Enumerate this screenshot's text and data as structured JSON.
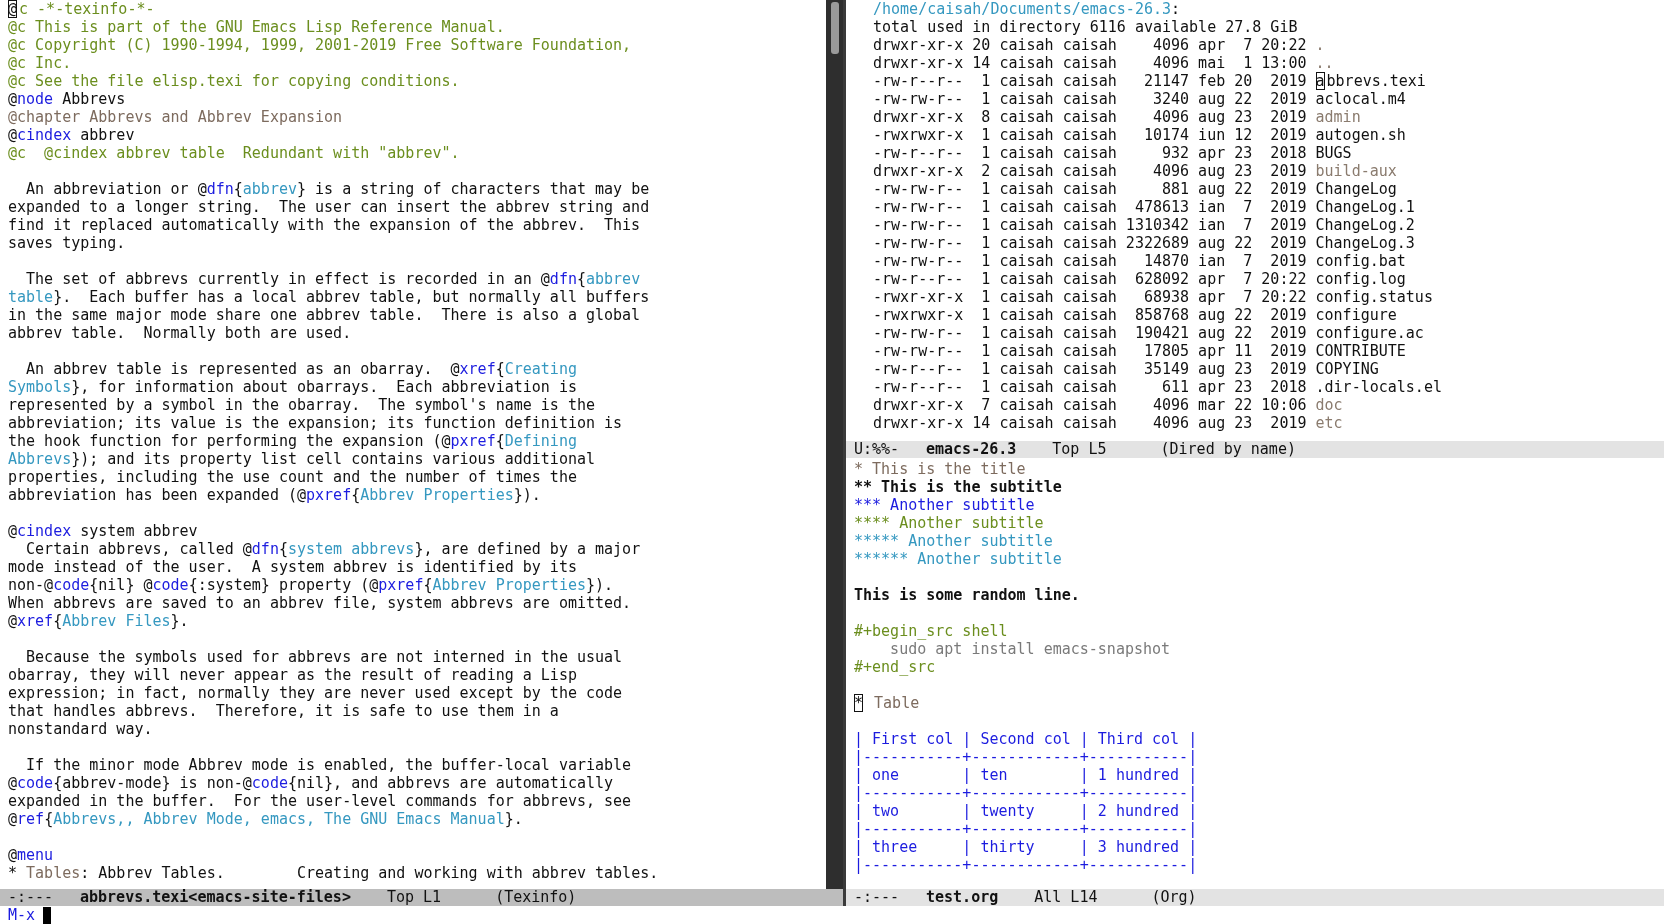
{
  "texinfo_pane": {
    "blocks": [
      [
        [
          {
            "text": "@",
            "kind": "cursor"
          },
          {
            "text": "c -*-texinfo-*-",
            "kind": "comment"
          }
        ],
        [
          {
            "text": "@c This is part of the GNU Emacs Lisp Reference Manual.",
            "kind": "comment"
          }
        ],
        [
          {
            "text": "@c Copyright (C) 1990-1994, 1999, 2001-2019 Free Software Foundation,",
            "kind": "comment"
          }
        ],
        [
          {
            "text": "@c Inc.",
            "kind": "comment"
          }
        ],
        [
          {
            "text": "@c See the file elisp.texi for copying conditions.",
            "kind": "comment"
          }
        ],
        [
          {
            "text": "@",
            "kind": "plain"
          },
          {
            "text": "node",
            "kind": "keyword"
          },
          {
            "text": " Abbrevs",
            "kind": "plain"
          }
        ],
        [
          {
            "text": "@chapter Abbrevs and Abbrev Expansion",
            "kind": "chapter"
          }
        ],
        [
          {
            "text": "@",
            "kind": "plain"
          },
          {
            "text": "cindex",
            "kind": "keyword"
          },
          {
            "text": " abbrev",
            "kind": "plain"
          }
        ],
        [
          {
            "text": "@c  @cindex abbrev table  Redundant with \"abbrev\".",
            "kind": "comment"
          }
        ]
      ],
      [
        [
          {
            "text": "  An abbreviation or @",
            "kind": "plain"
          },
          {
            "text": "dfn",
            "kind": "keyword"
          },
          {
            "text": "{",
            "kind": "plain"
          },
          {
            "text": "abbrev",
            "kind": "link"
          },
          {
            "text": "} is a string of characters that may be",
            "kind": "plain"
          }
        ],
        [
          {
            "text": "expanded to a longer string.  The user can insert the abbrev string and",
            "kind": "plain"
          }
        ],
        [
          {
            "text": "find it replaced automatically with the expansion of the abbrev.  This",
            "kind": "plain"
          }
        ],
        [
          {
            "text": "saves typing.",
            "kind": "plain"
          }
        ]
      ],
      [
        [
          {
            "text": "  The set of abbrevs currently in effect is recorded in an @",
            "kind": "plain"
          },
          {
            "text": "dfn",
            "kind": "keyword"
          },
          {
            "text": "{",
            "kind": "plain"
          },
          {
            "text": "abbrev",
            "kind": "link"
          }
        ],
        [
          {
            "text": "table",
            "kind": "link"
          },
          {
            "text": "}.  Each buffer has a local abbrev table, but normally all buffers",
            "kind": "plain"
          }
        ],
        [
          {
            "text": "in the same major mode share one abbrev table.  There is also a global",
            "kind": "plain"
          }
        ],
        [
          {
            "text": "abbrev table.  Normally both are used.",
            "kind": "plain"
          }
        ]
      ],
      [
        [
          {
            "text": "  An abbrev table is represented as an obarray.  @",
            "kind": "plain"
          },
          {
            "text": "xref",
            "kind": "keyword"
          },
          {
            "text": "{",
            "kind": "plain"
          },
          {
            "text": "Creating",
            "kind": "link"
          }
        ],
        [
          {
            "text": "Symbols",
            "kind": "link"
          },
          {
            "text": "}, for information about obarrays.  Each abbreviation is",
            "kind": "plain"
          }
        ],
        [
          {
            "text": "represented by a symbol in the obarray.  The symbol's name is the",
            "kind": "plain"
          }
        ],
        [
          {
            "text": "abbreviation; its value is the expansion; its function definition is",
            "kind": "plain"
          }
        ],
        [
          {
            "text": "the hook function for performing the expansion (@",
            "kind": "plain"
          },
          {
            "text": "pxref",
            "kind": "keyword"
          },
          {
            "text": "{",
            "kind": "plain"
          },
          {
            "text": "Defining",
            "kind": "link"
          }
        ],
        [
          {
            "text": "Abbrevs",
            "kind": "link"
          },
          {
            "text": "}); and its property list cell contains various additional",
            "kind": "plain"
          }
        ],
        [
          {
            "text": "properties, including the use count and the number of times the",
            "kind": "plain"
          }
        ],
        [
          {
            "text": "abbreviation has been expanded (@",
            "kind": "plain"
          },
          {
            "text": "pxref",
            "kind": "keyword"
          },
          {
            "text": "{",
            "kind": "plain"
          },
          {
            "text": "Abbrev Properties",
            "kind": "link"
          },
          {
            "text": "}).",
            "kind": "plain"
          }
        ]
      ],
      [
        [
          {
            "text": "@",
            "kind": "plain"
          },
          {
            "text": "cindex",
            "kind": "keyword"
          },
          {
            "text": " system abbrev",
            "kind": "plain"
          }
        ],
        [
          {
            "text": "  Certain abbrevs, called @",
            "kind": "plain"
          },
          {
            "text": "dfn",
            "kind": "keyword"
          },
          {
            "text": "{",
            "kind": "plain"
          },
          {
            "text": "system abbrevs",
            "kind": "link"
          },
          {
            "text": "}, are defined by a major",
            "kind": "plain"
          }
        ],
        [
          {
            "text": "mode instead of the user.  A system abbrev is identified by its",
            "kind": "plain"
          }
        ],
        [
          {
            "text": "non-@",
            "kind": "plain"
          },
          {
            "text": "code",
            "kind": "keyword"
          },
          {
            "text": "{nil} @",
            "kind": "plain"
          },
          {
            "text": "code",
            "kind": "keyword"
          },
          {
            "text": "{:system} property (@",
            "kind": "plain"
          },
          {
            "text": "pxref",
            "kind": "keyword"
          },
          {
            "text": "{",
            "kind": "plain"
          },
          {
            "text": "Abbrev Properties",
            "kind": "link"
          },
          {
            "text": "}).",
            "kind": "plain"
          }
        ],
        [
          {
            "text": "When abbrevs are saved to an abbrev file, system abbrevs are omitted.",
            "kind": "plain"
          }
        ],
        [
          {
            "text": "@",
            "kind": "plain"
          },
          {
            "text": "xref",
            "kind": "keyword"
          },
          {
            "text": "{",
            "kind": "plain"
          },
          {
            "text": "Abbrev Files",
            "kind": "link"
          },
          {
            "text": "}.",
            "kind": "plain"
          }
        ]
      ],
      [
        [
          {
            "text": "  Because the symbols used for abbrevs are not interned in the usual",
            "kind": "plain"
          }
        ],
        [
          {
            "text": "obarray, they will never appear as the result of reading a Lisp",
            "kind": "plain"
          }
        ],
        [
          {
            "text": "expression; in fact, normally they are never used except by the code",
            "kind": "plain"
          }
        ],
        [
          {
            "text": "that handles abbrevs.  Therefore, it is safe to use them in a",
            "kind": "plain"
          }
        ],
        [
          {
            "text": "nonstandard way.",
            "kind": "plain"
          }
        ]
      ],
      [
        [
          {
            "text": "  If the minor mode Abbrev mode is enabled, the buffer-local variable",
            "kind": "plain"
          }
        ],
        [
          {
            "text": "@",
            "kind": "plain"
          },
          {
            "text": "code",
            "kind": "keyword"
          },
          {
            "text": "{abbrev-mode} is non-@",
            "kind": "plain"
          },
          {
            "text": "code",
            "kind": "keyword"
          },
          {
            "text": "{nil}, and abbrevs are automatically",
            "kind": "plain"
          }
        ],
        [
          {
            "text": "expanded in the buffer.  For the user-level commands for abbrevs, see",
            "kind": "plain"
          }
        ],
        [
          {
            "text": "@",
            "kind": "plain"
          },
          {
            "text": "ref",
            "kind": "keyword"
          },
          {
            "text": "{",
            "kind": "plain"
          },
          {
            "text": "Abbrevs,, Abbrev Mode, emacs, The GNU Emacs Manual",
            "kind": "link"
          },
          {
            "text": "}.",
            "kind": "plain"
          }
        ]
      ],
      [
        [
          {
            "text": "@",
            "kind": "plain"
          },
          {
            "text": "menu",
            "kind": "keyword"
          }
        ],
        [
          {
            "text": "* ",
            "kind": "plain"
          },
          {
            "text": "Tables",
            "kind": "chapter"
          },
          {
            "text": ": Abbrev Tables.        Creating and working with abbrev tables.",
            "kind": "plain"
          }
        ]
      ]
    ],
    "mode_line": {
      "active": true,
      "status": "-:---",
      "buffer": "abbrevs.texi<emacs-site-files>",
      "position": "Top L1",
      "mode": "(Texinfo)"
    }
  },
  "dired_pane": {
    "blocks": [
      [
        [
          {
            "text": "/home/caisah/Documents/emacs-26.3",
            "kind": "link"
          },
          {
            "text": ":",
            "kind": "plain"
          }
        ],
        [
          {
            "text": "total used in directory 6116 available 27.8 GiB",
            "kind": "plain"
          }
        ],
        [
          {
            "text": "drwxr-xr-x 20 caisah caisah    4096 apr  7 20:22 ",
            "kind": "plain"
          },
          {
            "text": ".",
            "kind": "dir"
          }
        ],
        [
          {
            "text": "drwxr-xr-x 14 caisah caisah    4096 mai  1 13:00 ",
            "kind": "plain"
          },
          {
            "text": "..",
            "kind": "dir"
          }
        ],
        [
          {
            "text": "-rw-r--r--  1 caisah caisah   21147 feb 20  2019 ",
            "kind": "plain"
          },
          {
            "text": "a",
            "kind": "cursor"
          },
          {
            "text": "bbrevs.texi",
            "kind": "plain"
          }
        ],
        [
          {
            "text": "-rw-rw-r--  1 caisah caisah    3240 aug 22  2019 aclocal.m4",
            "kind": "plain"
          }
        ],
        [
          {
            "text": "drwxr-xr-x  8 caisah caisah    4096 aug 23  2019 ",
            "kind": "plain"
          },
          {
            "text": "admin",
            "kind": "dir"
          }
        ],
        [
          {
            "text": "-rwxrwxr-x  1 caisah caisah   10174 iun 12  2019 autogen.sh",
            "kind": "plain"
          }
        ],
        [
          {
            "text": "-rw-r--r--  1 caisah caisah     932 apr 23  2018 BUGS",
            "kind": "plain"
          }
        ],
        [
          {
            "text": "drwxr-xr-x  2 caisah caisah    4096 aug 23  2019 ",
            "kind": "plain"
          },
          {
            "text": "build-aux",
            "kind": "dir"
          }
        ],
        [
          {
            "text": "-rw-rw-r--  1 caisah caisah     881 aug 22  2019 ChangeLog",
            "kind": "plain"
          }
        ],
        [
          {
            "text": "-rw-rw-r--  1 caisah caisah  478613 ian  7  2019 ChangeLog.1",
            "kind": "plain"
          }
        ],
        [
          {
            "text": "-rw-rw-r--  1 caisah caisah 1310342 ian  7  2019 ChangeLog.2",
            "kind": "plain"
          }
        ],
        [
          {
            "text": "-rw-rw-r--  1 caisah caisah 2322689 aug 22  2019 ChangeLog.3",
            "kind": "plain"
          }
        ],
        [
          {
            "text": "-rw-rw-r--  1 caisah caisah   14870 ian  7  2019 config.bat",
            "kind": "plain"
          }
        ],
        [
          {
            "text": "-rw-r--r--  1 caisah caisah  628092 apr  7 20:22 config.log",
            "kind": "plain"
          }
        ],
        [
          {
            "text": "-rwxr-xr-x  1 caisah caisah   68938 apr  7 20:22 config.status",
            "kind": "plain"
          }
        ],
        [
          {
            "text": "-rwxrwxr-x  1 caisah caisah  858768 aug 22  2019 configure",
            "kind": "plain"
          }
        ],
        [
          {
            "text": "-rw-rw-r--  1 caisah caisah  190421 aug 22  2019 configure.ac",
            "kind": "plain"
          }
        ],
        [
          {
            "text": "-rw-rw-r--  1 caisah caisah   17805 apr 11  2019 CONTRIBUTE",
            "kind": "plain"
          }
        ],
        [
          {
            "text": "-rw-r--r--  1 caisah caisah   35149 aug 23  2019 COPYING",
            "kind": "plain"
          }
        ],
        [
          {
            "text": "-rw-r--r--  1 caisah caisah     611 apr 23  2018 .dir-locals.el",
            "kind": "plain"
          }
        ],
        [
          {
            "text": "drwxr-xr-x  7 caisah caisah    4096 mar 22 10:06 ",
            "kind": "plain"
          },
          {
            "text": "doc",
            "kind": "dir"
          }
        ],
        [
          {
            "text": "drwxr-xr-x 14 caisah caisah    4096 aug 23  2019 ",
            "kind": "plain"
          },
          {
            "text": "etc",
            "kind": "dir"
          }
        ]
      ]
    ],
    "mode_line": {
      "active": false,
      "status": "U:%%-",
      "buffer": "emacs-26.3",
      "position": "Top L5",
      "mode": "(Dired by name)"
    }
  },
  "org_pane": {
    "blocks": [
      [
        [
          {
            "text": "* This is the title",
            "kind": "chapter"
          }
        ],
        [
          {
            "text": "** This is the subtitle",
            "kind": "bold"
          }
        ],
        [
          {
            "text": "*** Another subtitle",
            "kind": "keyword"
          }
        ],
        [
          {
            "text": "**** Another subtitle",
            "kind": "comment"
          }
        ],
        [
          {
            "text": "***** Another subtitle",
            "kind": "link"
          }
        ],
        [
          {
            "text": "****** Another subtitle",
            "kind": "link"
          }
        ]
      ],
      [
        [
          {
            "text": "This is some random line.",
            "kind": "bold"
          }
        ]
      ],
      [
        [
          {
            "text": "#+begin_src shell",
            "kind": "comment"
          }
        ],
        [
          {
            "text": "    sudo apt install emacs-snapshot",
            "kind": "code"
          }
        ],
        [
          {
            "text": "#+end_src",
            "kind": "comment"
          }
        ]
      ],
      [
        [
          {
            "text": "*",
            "kind": "cursor"
          },
          {
            "text": " Table",
            "kind": "chapter"
          }
        ]
      ],
      [
        [
          {
            "text": "| First col | Second col | Third col |",
            "kind": "keyword"
          }
        ],
        [
          {
            "text": "|-----------+------------+-----------|",
            "kind": "keyword"
          }
        ],
        [
          {
            "text": "| one       | ten        | 1 hundred |",
            "kind": "keyword"
          }
        ],
        [
          {
            "text": "|-----------+------------+-----------|",
            "kind": "keyword"
          }
        ],
        [
          {
            "text": "| two       | twenty     | 2 hundred |",
            "kind": "keyword"
          }
        ],
        [
          {
            "text": "|-----------+------------+-----------|",
            "kind": "keyword"
          }
        ],
        [
          {
            "text": "| three     | thirty     | 3 hundred |",
            "kind": "keyword"
          }
        ],
        [
          {
            "text": "|-----------+------------+-----------|",
            "kind": "keyword"
          }
        ]
      ]
    ],
    "mode_line": {
      "active": false,
      "status": "-:---",
      "buffer": "test.org",
      "position": "All L14",
      "mode": "(Org)"
    }
  },
  "minibuffer": {
    "prompt": "M-x"
  }
}
